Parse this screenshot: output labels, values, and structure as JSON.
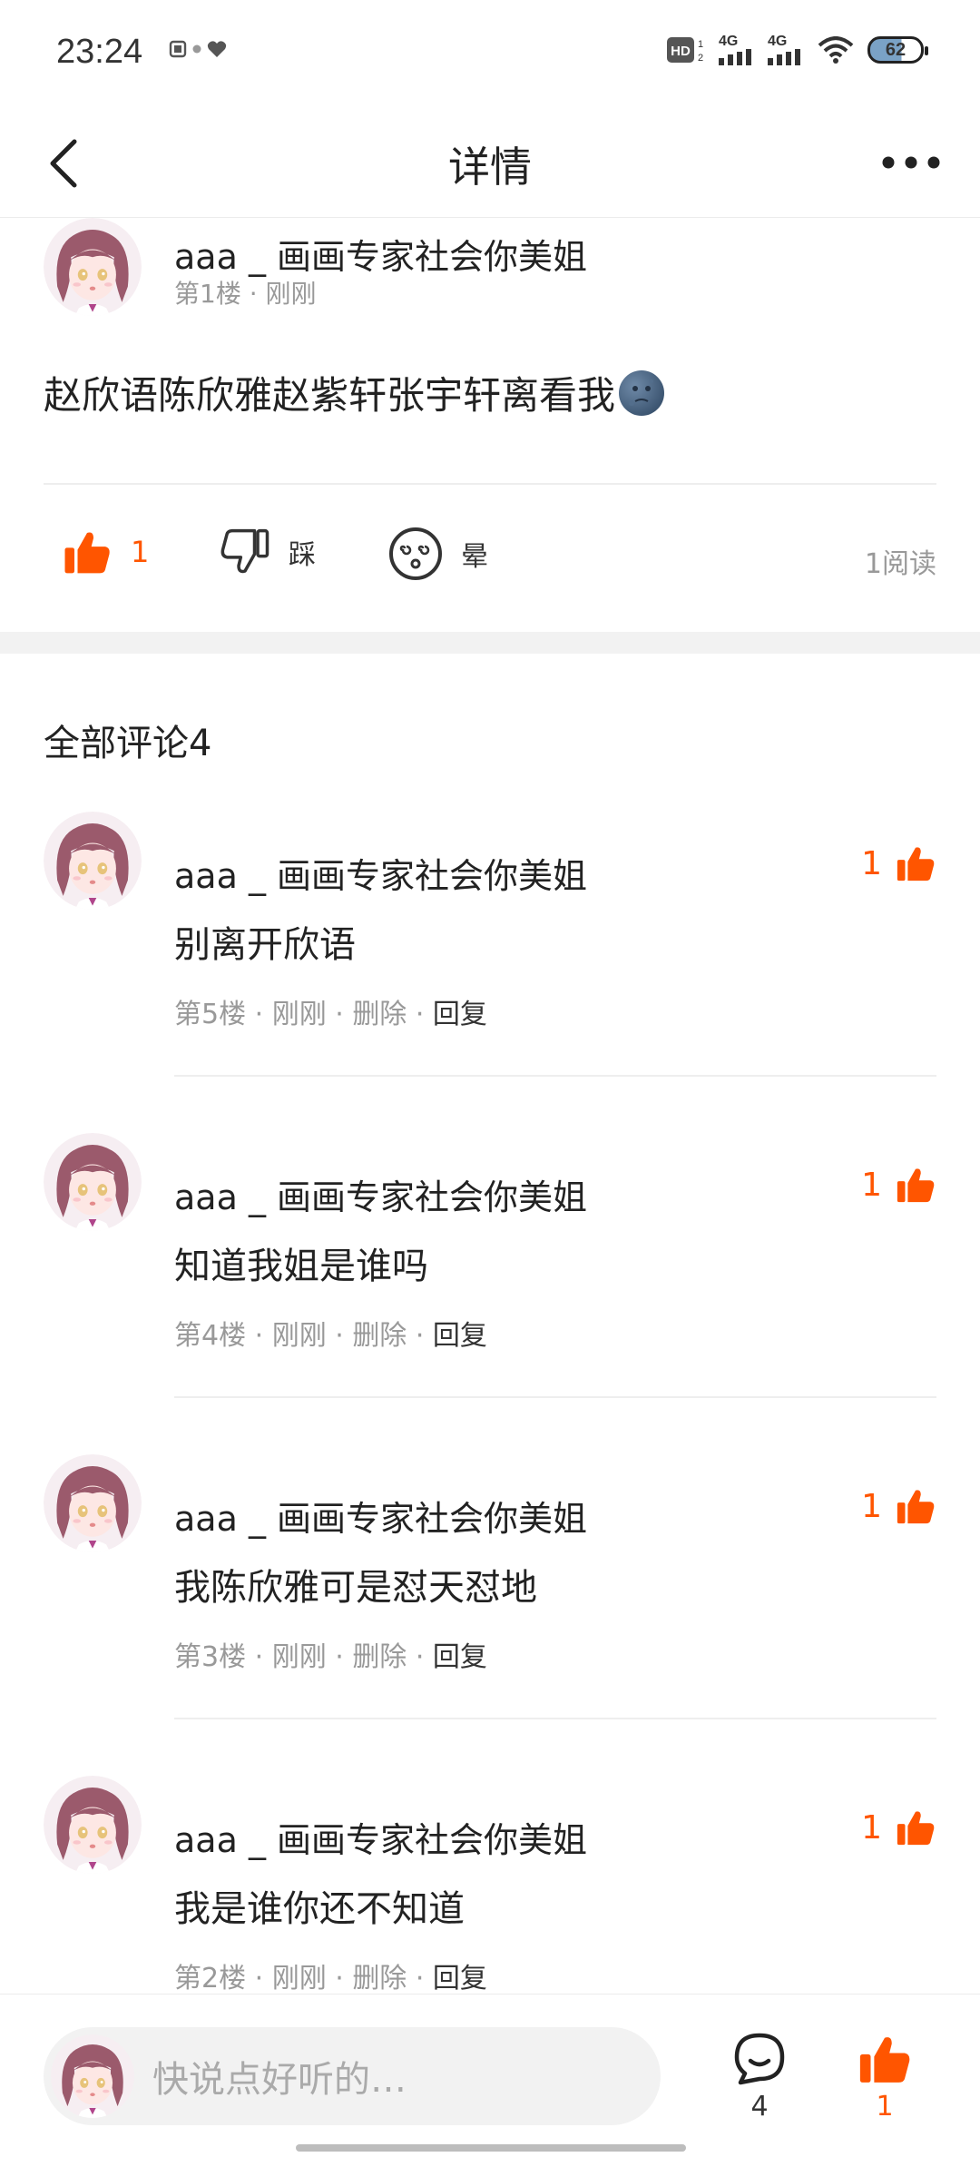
{
  "status_bar": {
    "time": "23:24",
    "network_labels": [
      "4G",
      "4G"
    ],
    "battery": "62",
    "icons": [
      "hd-icon",
      "signal-icon",
      "wifi-icon",
      "battery-icon"
    ]
  },
  "header": {
    "title": "详情",
    "back_icon": "chevron-left-icon",
    "more_icon": "more-dots-icon"
  },
  "post": {
    "author": "aaa _ 画画专家社会你美姐",
    "floor": "第1楼",
    "time": "刚刚",
    "content": "赵欣语陈欣雅赵紫轩张宇轩离看我",
    "emoji": "moon-face",
    "like_count": "1",
    "dislike_label": "踩",
    "dizzy_label": "晕",
    "read_count": "1阅读"
  },
  "comments_section": {
    "title": "全部评论4"
  },
  "comments": [
    {
      "author": "aaa _ 画画专家社会你美姐",
      "text": "别离开欣语",
      "floor": "第5楼",
      "time": "刚刚",
      "delete": "删除",
      "reply": "回复",
      "likes": "1"
    },
    {
      "author": "aaa _ 画画专家社会你美姐",
      "text": "知道我姐是谁吗",
      "floor": "第4楼",
      "time": "刚刚",
      "delete": "删除",
      "reply": "回复",
      "likes": "1"
    },
    {
      "author": "aaa _ 画画专家社会你美姐",
      "text": "我陈欣雅可是怼天怼地",
      "floor": "第3楼",
      "time": "刚刚",
      "delete": "删除",
      "reply": "回复",
      "likes": "1"
    },
    {
      "author": "aaa _ 画画专家社会你美姐",
      "text": "我是谁你还不知道",
      "floor": "第2楼",
      "time": "刚刚",
      "delete": "删除",
      "reply": "回复",
      "likes": "1"
    }
  ],
  "bottom_bar": {
    "input_placeholder": "快说点好听的…",
    "comment_count": "4",
    "like_count": "1"
  },
  "colors": {
    "accent": "#ff5500",
    "muted": "#999999",
    "divider": "#eeeeee"
  }
}
